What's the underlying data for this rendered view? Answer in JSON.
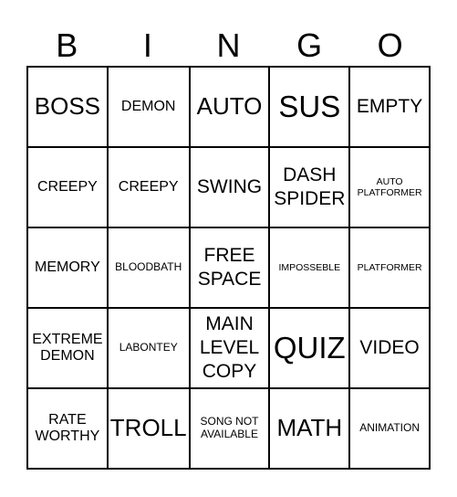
{
  "header": {
    "letters": [
      "B",
      "I",
      "N",
      "G",
      "O"
    ]
  },
  "card": {
    "cells": [
      {
        "text": "BOSS",
        "size": "l"
      },
      {
        "text": "DEMON",
        "size": "sm"
      },
      {
        "text": "AUTO",
        "size": "l"
      },
      {
        "text": "SUS",
        "size": "xl"
      },
      {
        "text": "EMPTY",
        "size": "m"
      },
      {
        "text": "CREEPY",
        "size": "sm"
      },
      {
        "text": "CREEPY",
        "size": "sm"
      },
      {
        "text": "SWING",
        "size": "m"
      },
      {
        "text": "DASH\nSPIDER",
        "size": "m"
      },
      {
        "text": "AUTO\nPLATFORMER",
        "size": "xxs"
      },
      {
        "text": "MEMORY",
        "size": "sm"
      },
      {
        "text": "BLOODBATH",
        "size": "xs"
      },
      {
        "text": "FREE\nSPACE",
        "size": "m"
      },
      {
        "text": "IMPOSSEBLE",
        "size": "xxs"
      },
      {
        "text": "PLATFORMER",
        "size": "xxs"
      },
      {
        "text": "EXTREME\nDEMON",
        "size": "sm"
      },
      {
        "text": "LABONTEY",
        "size": "xs"
      },
      {
        "text": "MAIN\nLEVEL\nCOPY",
        "size": "m"
      },
      {
        "text": "QUIZ",
        "size": "xl"
      },
      {
        "text": "VIDEO",
        "size": "m"
      },
      {
        "text": "RATE\nWORTHY",
        "size": "sm"
      },
      {
        "text": "TROLL",
        "size": "l"
      },
      {
        "text": "SONG NOT\nAVAILABLE",
        "size": "xs"
      },
      {
        "text": "MATH",
        "size": "l"
      },
      {
        "text": "ANIMATION",
        "size": "xs"
      }
    ]
  }
}
